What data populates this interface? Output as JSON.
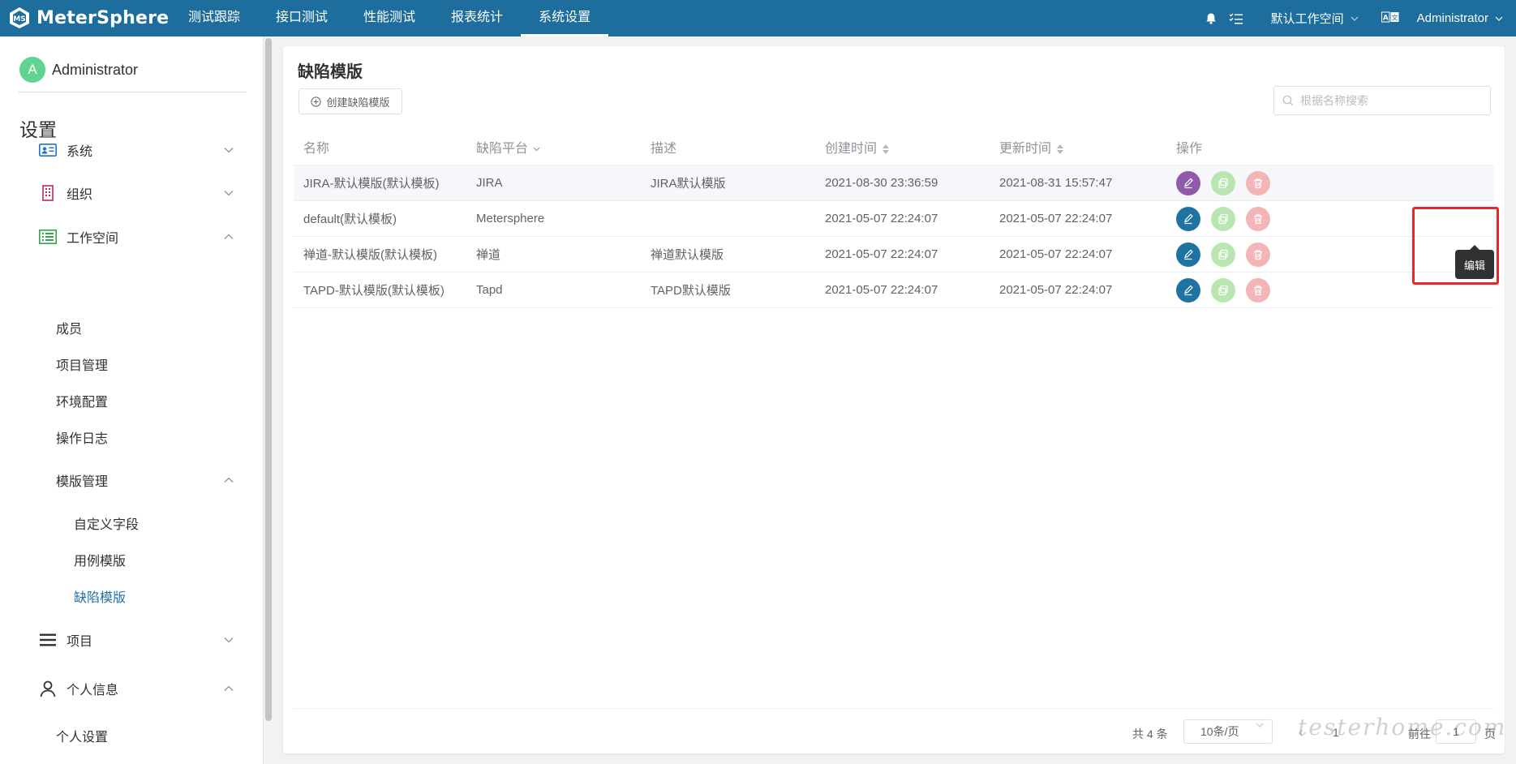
{
  "app": {
    "name": "MeterSphere",
    "nav": [
      "测试跟踪",
      "接口测试",
      "性能测试",
      "报表统计",
      "系统设置"
    ],
    "active_nav": "系统设置",
    "workspace": "默认工作空间",
    "user": "Administrator",
    "accent_color": "#1d6e9c"
  },
  "sidebar": {
    "avatar_letter": "A",
    "user_name": "Administrator",
    "title": "设置",
    "groups": [
      {
        "label": "系统",
        "icon": "id-card-icon",
        "expanded": false
      },
      {
        "label": "组织",
        "icon": "building-icon",
        "expanded": false
      },
      {
        "label": "工作空间",
        "icon": "list-icon",
        "expanded": true,
        "items": [
          "成员",
          "项目管理",
          "环境配置",
          "操作日志"
        ],
        "sub_group": {
          "label": "模版管理",
          "expanded": true,
          "items": [
            "自定义字段",
            "用例模版",
            "缺陷模版"
          ]
        }
      },
      {
        "label": "项目",
        "icon": "menu-icon",
        "expanded": false
      },
      {
        "label": "个人信息",
        "icon": "user-icon",
        "expanded": true,
        "items": [
          "个人设置"
        ]
      }
    ],
    "active_item": "缺陷模版"
  },
  "main": {
    "title": "缺陷模版",
    "create_button": "创建缺陷模版",
    "search_placeholder": "根据名称搜索",
    "columns": [
      "名称",
      "缺陷平台",
      "描述",
      "创建时间",
      "更新时间",
      "操作"
    ],
    "rows": [
      {
        "name": "JIRA-默认模版(默认模板)",
        "platform": "JIRA",
        "desc": "JIRA默认模版",
        "created": "2021-08-30 23:36:59",
        "updated": "2021-08-31 15:57:47"
      },
      {
        "name": "default(默认模板)",
        "platform": "Metersphere",
        "desc": "",
        "created": "2021-05-07 22:24:07",
        "updated": "2021-05-07 22:24:07"
      },
      {
        "name": "禅道-默认模版(默认模板)",
        "platform": "禅道",
        "desc": "禅道默认模版",
        "created": "2021-05-07 22:24:07",
        "updated": "2021-05-07 22:24:07"
      },
      {
        "name": "TAPD-默认模版(默认模板)",
        "platform": "Tapd",
        "desc": "TAPD默认模版",
        "created": "2021-05-07 22:24:07",
        "updated": "2021-05-07 22:24:07"
      }
    ],
    "tooltip": "编辑",
    "pagination": {
      "total": "共 4 条",
      "page_size": "10条/页",
      "current": "1",
      "goto_label": "前往",
      "goto_value": "1",
      "page_unit": "页"
    }
  },
  "watermark": "testerhome.com"
}
